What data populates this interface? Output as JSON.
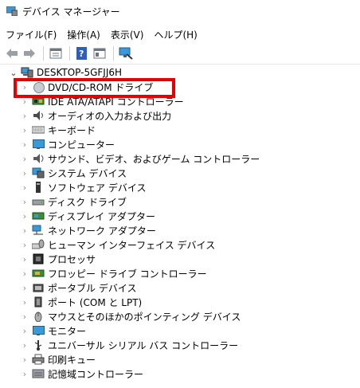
{
  "window": {
    "title": "デバイス マネージャー"
  },
  "menu": [
    "ファイル(F)",
    "操作(A)",
    "表示(V)",
    "ヘルプ(H)"
  ],
  "toolbar_icons": [
    "back-icon",
    "forward-icon",
    "properties-icon",
    "help-icon",
    "view-icon",
    "scan-hardware-icon"
  ],
  "tree": {
    "root": "DESKTOP-5GFJJ6H",
    "children": [
      {
        "label": "DVD/CD-ROM ドライブ",
        "icon": "dvd-drive-icon"
      },
      {
        "label": "IDE ATA/ATAPI コントローラー",
        "icon": "ide-controller-icon"
      },
      {
        "label": "オーディオの入力および出力",
        "icon": "audio-icon"
      },
      {
        "label": "キーボード",
        "icon": "keyboard-icon"
      },
      {
        "label": "コンピューター",
        "icon": "computer-icon"
      },
      {
        "label": "サウンド、ビデオ、およびゲーム コントローラー",
        "icon": "sound-icon"
      },
      {
        "label": "システム デバイス",
        "icon": "system-device-icon"
      },
      {
        "label": "ソフトウェア デバイス",
        "icon": "software-device-icon"
      },
      {
        "label": "ディスク ドライブ",
        "icon": "disk-drive-icon"
      },
      {
        "label": "ディスプレイ アダプター",
        "icon": "display-adapter-icon"
      },
      {
        "label": "ネットワーク アダプター",
        "icon": "network-adapter-icon"
      },
      {
        "label": "ヒューマン インターフェイス デバイス",
        "icon": "hid-icon"
      },
      {
        "label": "プロセッサ",
        "icon": "processor-icon"
      },
      {
        "label": "フロッピー ドライブ コントローラー",
        "icon": "floppy-controller-icon"
      },
      {
        "label": "ポータブル デバイス",
        "icon": "portable-device-icon"
      },
      {
        "label": "ポート (COM と LPT)",
        "icon": "port-icon"
      },
      {
        "label": "マウスとそのほかのポインティング デバイス",
        "icon": "mouse-icon"
      },
      {
        "label": "モニター",
        "icon": "monitor-icon"
      },
      {
        "label": "ユニバーサル シリアル バス コントローラー",
        "icon": "usb-icon"
      },
      {
        "label": "印刷キュー",
        "icon": "print-queue-icon"
      },
      {
        "label": "記憶域コントローラー",
        "icon": "storage-controller-icon"
      }
    ]
  },
  "highlight_color": "#e60000"
}
